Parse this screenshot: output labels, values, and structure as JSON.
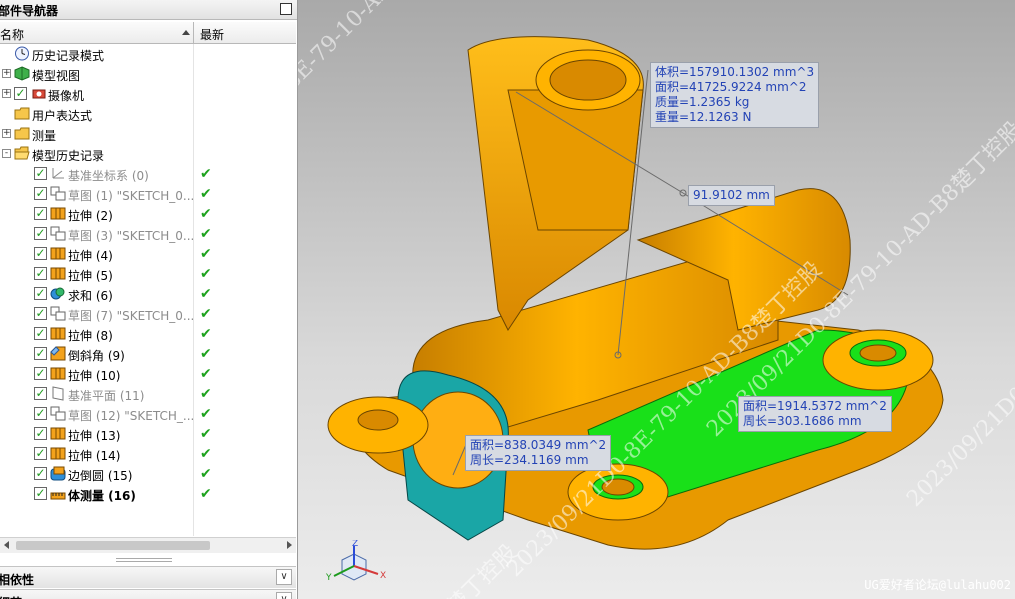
{
  "navigator": {
    "title": "部件导航器",
    "columns": {
      "name": "名称",
      "latest": "最新"
    },
    "rows": [
      {
        "label": "历史记录模式",
        "indent": 0,
        "icon": "clock-icon",
        "expander": "",
        "check": false,
        "style": "normal",
        "latest": ""
      },
      {
        "label": "模型视图",
        "indent": 0,
        "icon": "model-views-icon",
        "expander": "+",
        "check": false,
        "style": "normal",
        "latest": ""
      },
      {
        "label": "摄像机",
        "indent": 0,
        "icon": "camera-icon",
        "expander": "+",
        "check": true,
        "style": "normal",
        "latest": ""
      },
      {
        "label": "用户表达式",
        "indent": 0,
        "icon": "folder-icon",
        "expander": "",
        "check": false,
        "style": "normal",
        "latest": ""
      },
      {
        "label": "测量",
        "indent": 0,
        "icon": "folder-icon",
        "expander": "+",
        "check": false,
        "style": "normal",
        "latest": ""
      },
      {
        "label": "模型历史记录",
        "indent": 0,
        "icon": "folder-open-icon",
        "expander": "-",
        "check": false,
        "style": "normal",
        "latest": ""
      },
      {
        "label": "基准坐标系 (0)",
        "indent": 1,
        "icon": "datum-csys-icon",
        "expander": "",
        "check": true,
        "style": "grey",
        "latest": "✔"
      },
      {
        "label": "草图 (1) \"SKETCH_0...",
        "indent": 1,
        "icon": "sketch-icon",
        "expander": "",
        "check": true,
        "style": "grey",
        "latest": "✔"
      },
      {
        "label": "拉伸 (2)",
        "indent": 1,
        "icon": "extrude-icon",
        "expander": "",
        "check": true,
        "style": "normal",
        "latest": "✔"
      },
      {
        "label": "草图 (3) \"SKETCH_0...",
        "indent": 1,
        "icon": "sketch-icon",
        "expander": "",
        "check": true,
        "style": "grey",
        "latest": "✔"
      },
      {
        "label": "拉伸 (4)",
        "indent": 1,
        "icon": "extrude-icon",
        "expander": "",
        "check": true,
        "style": "normal",
        "latest": "✔"
      },
      {
        "label": "拉伸 (5)",
        "indent": 1,
        "icon": "extrude-icon",
        "expander": "",
        "check": true,
        "style": "normal",
        "latest": "✔"
      },
      {
        "label": "求和 (6)",
        "indent": 1,
        "icon": "unite-icon",
        "expander": "",
        "check": true,
        "style": "normal",
        "latest": "✔"
      },
      {
        "label": "草图 (7) \"SKETCH_0...",
        "indent": 1,
        "icon": "sketch-icon",
        "expander": "",
        "check": true,
        "style": "grey",
        "latest": "✔"
      },
      {
        "label": "拉伸 (8)",
        "indent": 1,
        "icon": "extrude-icon",
        "expander": "",
        "check": true,
        "style": "normal",
        "latest": "✔"
      },
      {
        "label": "倒斜角 (9)",
        "indent": 1,
        "icon": "chamfer-icon",
        "expander": "",
        "check": true,
        "style": "normal",
        "latest": "✔"
      },
      {
        "label": "拉伸 (10)",
        "indent": 1,
        "icon": "extrude-icon",
        "expander": "",
        "check": true,
        "style": "normal",
        "latest": "✔"
      },
      {
        "label": "基准平面 (11)",
        "indent": 1,
        "icon": "datum-plane-icon",
        "expander": "",
        "check": true,
        "style": "grey",
        "latest": "✔"
      },
      {
        "label": "草图 (12) \"SKETCH_...",
        "indent": 1,
        "icon": "sketch-icon",
        "expander": "",
        "check": true,
        "style": "grey",
        "latest": "✔"
      },
      {
        "label": "拉伸 (13)",
        "indent": 1,
        "icon": "extrude-icon",
        "expander": "",
        "check": true,
        "style": "normal",
        "latest": "✔"
      },
      {
        "label": "拉伸 (14)",
        "indent": 1,
        "icon": "extrude-icon",
        "expander": "",
        "check": true,
        "style": "normal",
        "latest": "✔"
      },
      {
        "label": "边倒圆 (15)",
        "indent": 1,
        "icon": "edge-blend-icon",
        "expander": "",
        "check": true,
        "style": "normal",
        "latest": "✔"
      },
      {
        "label": "体测量 (16)",
        "indent": 1,
        "icon": "measure-body-icon",
        "expander": "",
        "check": true,
        "style": "bold",
        "latest": "✔"
      }
    ],
    "sections": [
      "相依性",
      "细节"
    ]
  },
  "viewport": {
    "callouts": [
      {
        "id": "mass-props",
        "lines": [
          "体积=157910.1302 mm^3",
          "面积=41725.9224 mm^2",
          "质量=1.2365 kg",
          "重量=12.1263 N"
        ]
      },
      {
        "id": "distance",
        "lines": [
          "91.9102 mm"
        ]
      },
      {
        "id": "face-right",
        "lines": [
          "面积=1914.5372 mm^2",
          "周长=303.1686 mm"
        ]
      },
      {
        "id": "face-left",
        "lines": [
          "面积=838.0349 mm^2",
          "周长=234.1169 mm"
        ]
      }
    ],
    "watermark": "2023/09/21D0-8E-79-10-AD-B8楚丁控股",
    "watermark_short": "楚丁控股",
    "forum": "UG爱好者论坛@lulahu002",
    "triad": {
      "x": "X",
      "y": "Y",
      "z": "Z"
    },
    "colors": {
      "part": "#f5a300",
      "face_green": "#19e019",
      "face_teal": "#1aa6a6",
      "callout_text": "#2343b5"
    }
  }
}
